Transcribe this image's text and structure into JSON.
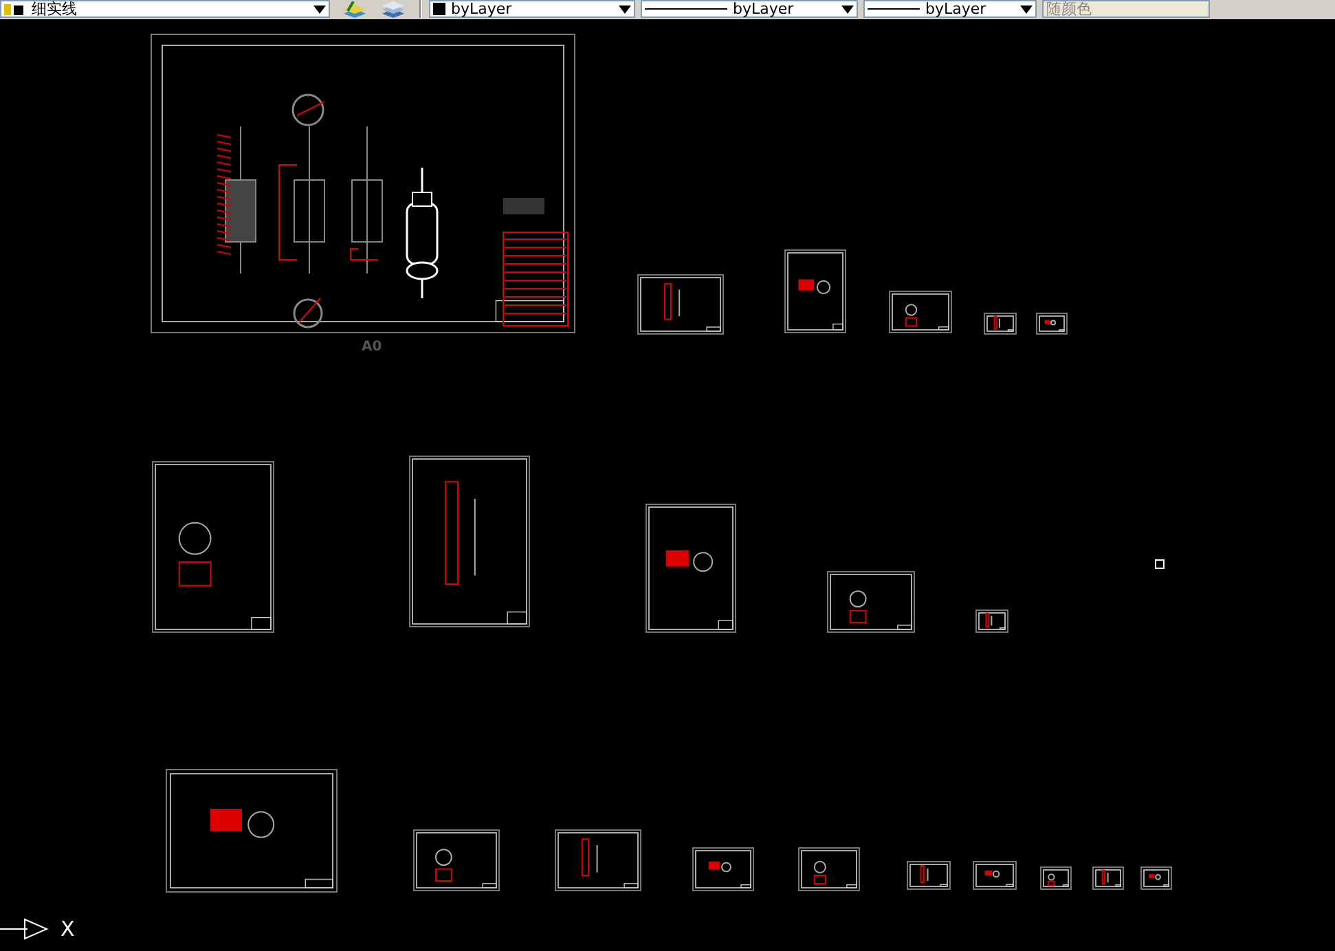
{
  "toolbar": {
    "layer": {
      "value": "细实线"
    },
    "color": {
      "value": "byLayer"
    },
    "linetype": {
      "value": "byLayer"
    },
    "lineweight": {
      "value": "byLayer"
    },
    "plot_style": {
      "value": "随颜色",
      "disabled": true
    }
  },
  "canvas": {
    "sheet_label": "A0",
    "ucs_axis_label": "X"
  }
}
